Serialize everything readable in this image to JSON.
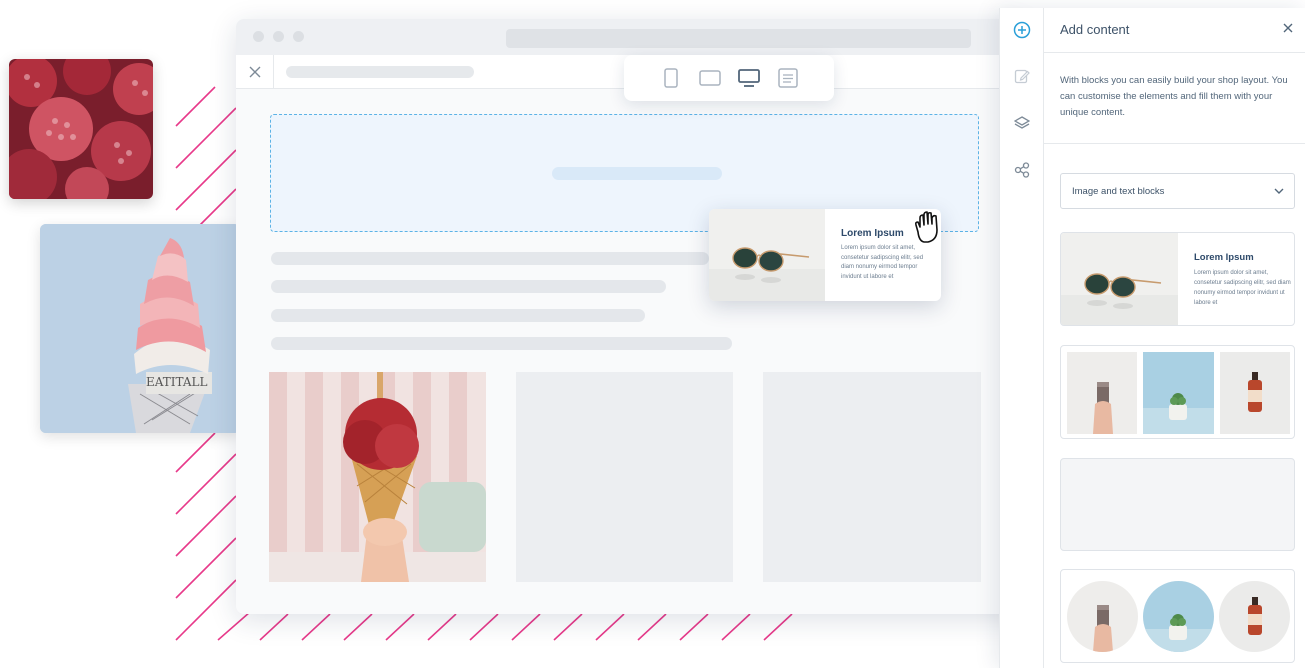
{
  "browser": {
    "device_modes": [
      {
        "name": "mobile",
        "icon": "smartphone-icon",
        "active": false
      },
      {
        "name": "tablet",
        "icon": "tablet-icon",
        "active": false
      },
      {
        "name": "desktop",
        "icon": "desktop-icon",
        "active": true
      },
      {
        "name": "list",
        "icon": "list-view-icon",
        "active": false
      }
    ]
  },
  "drag_card": {
    "title": "Lorem Ipsum",
    "body": "Lorem ipsum dolor sit amet, consetetur sadipscing elitr, sed diam nonumy eirmod tempor invidunt ut labore et"
  },
  "panel": {
    "title": "Add content",
    "description": "With blocks you can easily build your shop layout. You can customise the elements and fill them with your unique content.",
    "category_select": {
      "value": "Image and text blocks"
    },
    "rail_icons": [
      "add-circle-icon",
      "edit-icon",
      "layers-icon",
      "share-icon"
    ],
    "blocks": [
      {
        "type": "image-text",
        "title": "Lorem Ipsum",
        "body": "Lorem ipsum dolor sit amet, consetetur sadipscing elitr, sed diam nonumy eirmod tempor invidunt ut labore et"
      },
      {
        "type": "three-images"
      },
      {
        "type": "empty"
      },
      {
        "type": "three-circles"
      }
    ]
  },
  "colors": {
    "accent": "#2a9fd8",
    "dropzone_border": "#5db3e6",
    "stripes": "#e8398a",
    "heading": "#2e4a6a"
  }
}
